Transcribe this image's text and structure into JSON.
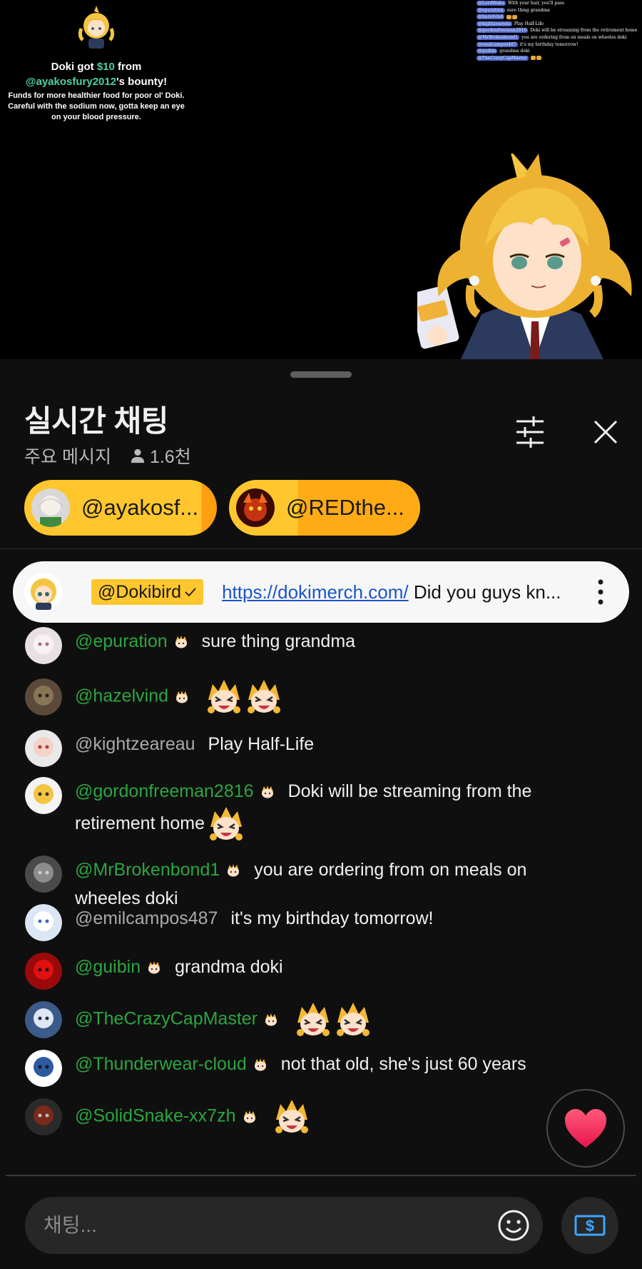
{
  "video": {
    "bounty": {
      "line1_prefix": "Doki got ",
      "amount": "$10",
      "line1_suffix": " from",
      "user": "@ayakosfury2012",
      "line2_suffix": "'s bounty!",
      "body": "Funds for more healthier food for poor ol' Doki. Careful with the sodium now, gotta keep an eye on your blood pressure."
    },
    "overlay_chat": [
      {
        "user": "@LordWaku",
        "text": "With your hair, you'll pass"
      },
      {
        "user": "@epuration",
        "text": "sure thing grandma"
      },
      {
        "user": "@hazelvind",
        "text": ""
      },
      {
        "user": "@kightzeareau",
        "text": "Play Half-Life"
      },
      {
        "user": "@gordonfreeman2816",
        "text": "Doki will be streaming from the retirement home"
      },
      {
        "user": "@MrBrokenbond1",
        "text": "you are ordering from on meals on wheeles doki"
      },
      {
        "user": "@emilcampos487",
        "text": "it's my birthday tomorrow!"
      },
      {
        "user": "@guibin",
        "text": "grandma doki"
      },
      {
        "user": "@TheCrazyCapMaster",
        "text": ""
      }
    ]
  },
  "header": {
    "title": "실시간 채팅",
    "filter_label": "주요 메시지",
    "viewer_count": "1.6천"
  },
  "pills": [
    {
      "name": "@ayakosf..."
    },
    {
      "name": "@REDthe..."
    }
  ],
  "pinned": {
    "author": "@Dokibird",
    "link": "https://dokimerch.com/",
    "text": " Did you guys kn..."
  },
  "messages": [
    {
      "user": "@epuration",
      "text": "sure thing grandma",
      "member": true
    },
    {
      "user": "@hazelvind",
      "text": "",
      "member": true,
      "emotes": 2
    },
    {
      "user": "@kightzeareau",
      "text": "Play Half-Life",
      "member": false
    },
    {
      "user": "@gordonfreeman2816",
      "text": "Doki will be streaming from the retirement home",
      "member": true,
      "emotes": 1
    },
    {
      "user": "@MrBrokenbond1",
      "text": "you are ordering from on meals on wheeles doki",
      "member": true
    },
    {
      "user": "@emilcampos487",
      "text": "it's my birthday tomorrow!",
      "member": false
    },
    {
      "user": "@guibin",
      "text": "grandma doki",
      "member": true
    },
    {
      "user": "@TheCrazyCapMaster",
      "text": "",
      "member": true,
      "emotes": 2
    },
    {
      "user": "@Thunderwear-cloud",
      "text": "not that old, she's just 60 years",
      "member": true
    },
    {
      "user": "@SolidSnake-xx7zh",
      "text": "",
      "member": true,
      "emotes": 1
    }
  ],
  "input": {
    "placeholder": "채팅..."
  },
  "icons": {
    "filter": "sliders-icon",
    "close": "close-icon",
    "viewer": "person-icon",
    "emoji": "smiley-icon",
    "super_chat": "dollar-bill-icon",
    "heart": "heart-icon",
    "more": "more-vert-icon"
  },
  "colors": {
    "accent_yellow": "#ffc62e",
    "member_green": "#2ba640",
    "link_blue": "#1a55c9",
    "heart_red": "#ff2e63"
  }
}
